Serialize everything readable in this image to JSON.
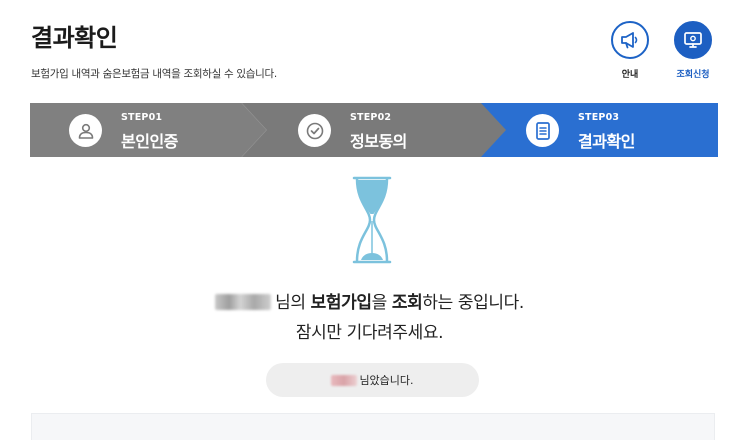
{
  "page": {
    "title": "결과확인",
    "description": "보험가입 내역과 숨은보험금 내역을 조회하실 수 있습니다."
  },
  "top_actions": [
    {
      "label": "안내",
      "icon": "megaphone-icon"
    },
    {
      "label": "조회신청",
      "icon": "monitor-icon"
    }
  ],
  "steps": [
    {
      "number": "STEP01",
      "label": "본인인증",
      "icon": "user-icon",
      "active": false
    },
    {
      "number": "STEP02",
      "label": "정보동의",
      "icon": "check-circle-icon",
      "active": false
    },
    {
      "number": "STEP03",
      "label": "결과확인",
      "icon": "document-icon",
      "active": true
    }
  ],
  "colors": {
    "step_inactive": "#7f7f7f",
    "step_inactive_dark": "#6e6e6e",
    "step_active": "#2a6fd1",
    "accent_blue": "#1d5fc2",
    "hourglass": "#7cc2dd"
  },
  "status": {
    "name_suffix": "님의",
    "bold_1": "보험가입",
    "text_1": "을",
    "bold_2": "조회",
    "text_2": "하는 중입니다.",
    "line_2": "잠시만 기다려주세요."
  },
  "notice": {
    "text": "님았습니다."
  }
}
